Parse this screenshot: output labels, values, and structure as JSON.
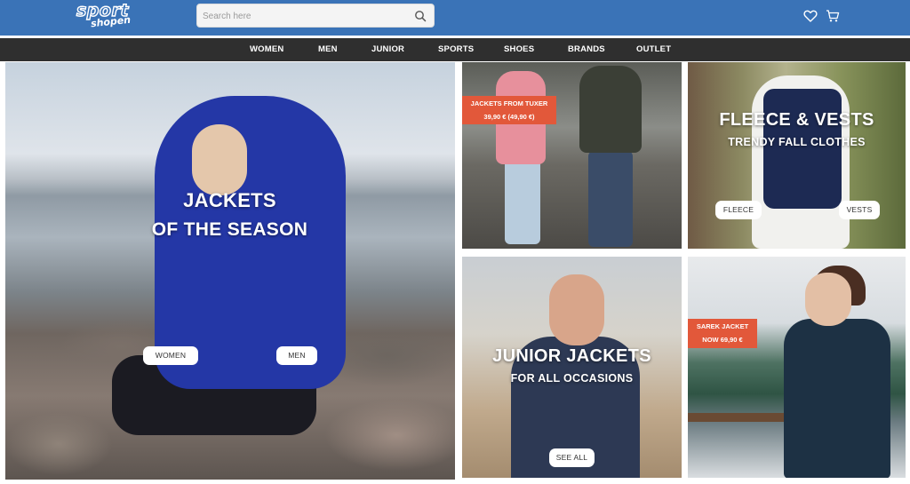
{
  "header": {
    "logo_line1": "sport",
    "logo_line2": "shopen",
    "search_placeholder": "Search here",
    "icons": {
      "search": "search-icon",
      "wishlist": "heart-icon",
      "cart": "cart-icon"
    }
  },
  "nav": {
    "items": [
      {
        "label": "WOMEN"
      },
      {
        "label": "MEN"
      },
      {
        "label": "JUNIOR"
      },
      {
        "label": "SPORTS"
      },
      {
        "label": "SHOES"
      },
      {
        "label": "BRANDS"
      },
      {
        "label": "OUTLET"
      }
    ]
  },
  "hero": {
    "title_line1": "JACKETS",
    "title_line2": "OF THE SEASON",
    "button_women": "WOMEN",
    "button_men": "MEN"
  },
  "tuxer": {
    "badge_line1": "JACKETS FROM TUXER",
    "badge_line2": "39,90 € (49,90 €)"
  },
  "fleece": {
    "title": "FLEECE & VESTS",
    "subtitle": "TRENDY FALL CLOTHES",
    "button_fleece": "FLEECE",
    "button_vests": "VESTS"
  },
  "junior": {
    "title": "JUNIOR JACKETS",
    "subtitle": "FOR ALL OCCASIONS",
    "button_see_all": "SEE ALL"
  },
  "sarek": {
    "badge_line1": "SAREK JACKET",
    "badge_line2": "NOW 69,90 €"
  },
  "colors": {
    "header_blue": "#3a73b7",
    "nav_dark": "#2f2f2f",
    "badge_orange": "#e2583a"
  }
}
